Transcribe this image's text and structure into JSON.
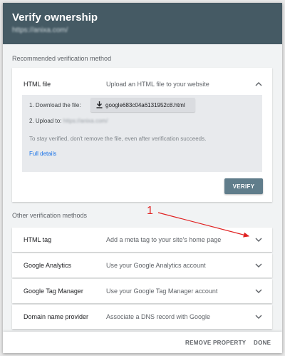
{
  "dialog": {
    "title": "Verify ownership",
    "url": "https://anixa.com/"
  },
  "recommended": {
    "section_label": "Recommended verification method",
    "title": "HTML file",
    "description": "Upload an HTML file to your website",
    "step1_label": "1. Download the file:",
    "file_name": "google683c04a6131952c8.html",
    "step2_label": "2. Upload to:",
    "upload_url": "https://anixa.com/",
    "note": "To stay verified, don't remove the file, even after verification succeeds.",
    "details_link": "Full details",
    "verify_label": "VERIFY"
  },
  "other": {
    "section_label": "Other verification methods",
    "methods": [
      {
        "title": "HTML tag",
        "description": "Add a meta tag to your site's home page"
      },
      {
        "title": "Google Analytics",
        "description": "Use your Google Analytics account"
      },
      {
        "title": "Google Tag Manager",
        "description": "Use your Google Tag Manager account"
      },
      {
        "title": "Domain name provider",
        "description": "Associate a DNS record with Google"
      }
    ]
  },
  "footer": {
    "remove_label": "REMOVE PROPERTY",
    "done_label": "DONE"
  },
  "annotation": {
    "number": "1",
    "color": "#e02020"
  },
  "icons": {
    "expanded_chevron": "chevron-up-icon",
    "collapsed_chevron": "chevron-down-icon",
    "download": "download-icon"
  }
}
